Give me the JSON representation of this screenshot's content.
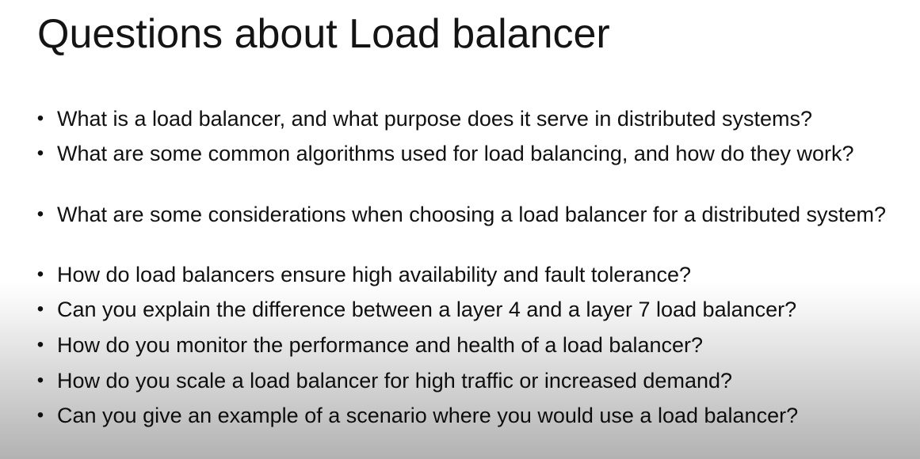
{
  "slide": {
    "title": "Questions about Load balancer",
    "bullet_glyph": "•",
    "questions": [
      "What is a load balancer, and what purpose does it serve in distributed systems?",
      "What are some common algorithms used for load balancing, and how do they work?",
      "What are some considerations when choosing a load balancer for a distributed system?",
      "How do load balancers ensure high availability and fault tolerance?",
      "Can you explain the difference between a layer 4 and a layer 7 load balancer?",
      "How do you monitor the performance and health of a load balancer?",
      "How do you scale a load balancer for high traffic or increased demand?",
      "Can you give an example of a scenario where you would use a load balancer?"
    ]
  }
}
